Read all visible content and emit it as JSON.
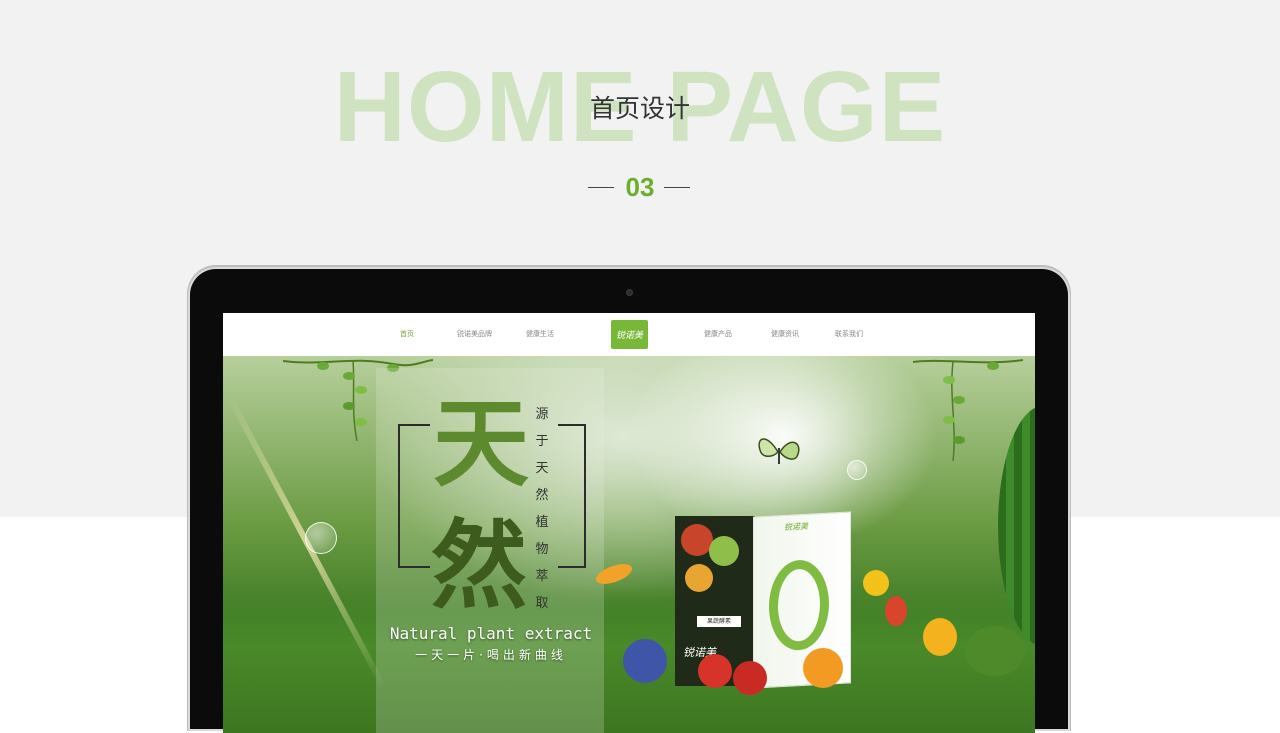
{
  "header": {
    "watermark": "HOME PAGE",
    "subtitle": "首页设计",
    "section_number": "03"
  },
  "nav": {
    "items": [
      {
        "label": "首页",
        "active": true
      },
      {
        "label": "锐诺美品牌",
        "active": false
      },
      {
        "label": "健康生活",
        "active": false
      },
      {
        "label": "健康产品",
        "active": false
      },
      {
        "label": "健康资讯",
        "active": false
      },
      {
        "label": "联系我们",
        "active": false
      }
    ],
    "logo_text": "锐诺美"
  },
  "hero": {
    "big_char_1": "天",
    "big_char_2": "然",
    "vertical_slogan": "源于天然植物萃取",
    "tagline_en": "Natural plant extract",
    "tagline_cn": "一天一片·喝出新曲线",
    "product_logo": "锐诺美",
    "product_side_logo": "锐诺美",
    "product_side_label": "果蔬酵素"
  },
  "colors": {
    "accent_green": "#6cae2c",
    "watermark": "#cfe3c0",
    "top_band": "#f2f2f2"
  }
}
